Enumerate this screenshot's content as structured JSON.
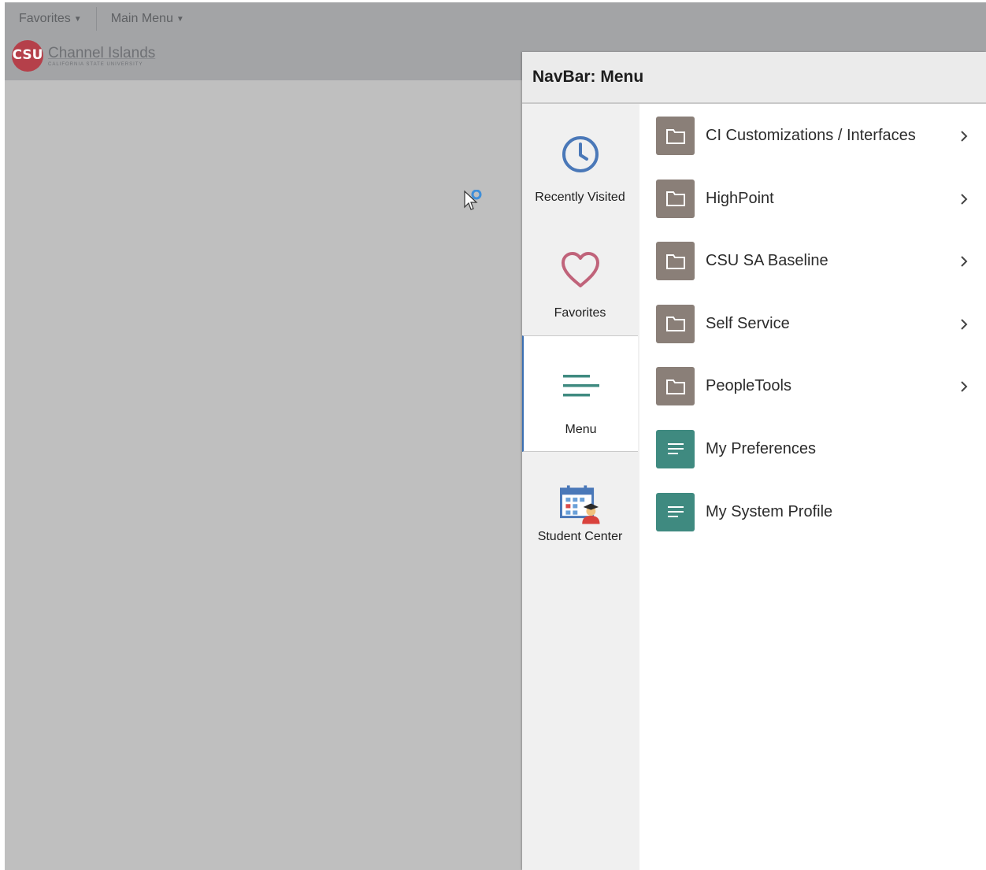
{
  "background": {
    "topnav": {
      "favorites_label": "Favorites",
      "main_menu_label": "Main Menu"
    },
    "brand": {
      "name": "Channel Islands",
      "subtitle": "CALIFORNIA STATE UNIVERSITY",
      "mark_text": "CSU"
    }
  },
  "navbar": {
    "title": "NavBar: Menu",
    "rail": [
      {
        "label": "Recently Visited",
        "icon": "clock-icon"
      },
      {
        "label": "Favorites",
        "icon": "heart-icon"
      },
      {
        "label": "Menu",
        "icon": "menu-lines-icon",
        "active": true
      },
      {
        "label": "Student Center",
        "icon": "calendar-student-icon"
      }
    ],
    "items": [
      {
        "label": "CI Customizations / Interfaces",
        "type": "folder"
      },
      {
        "label": "HighPoint",
        "type": "folder"
      },
      {
        "label": "CSU SA Baseline",
        "type": "folder"
      },
      {
        "label": "Self Service",
        "type": "folder"
      },
      {
        "label": "PeopleTools",
        "type": "folder"
      },
      {
        "label": "My Preferences",
        "type": "page"
      },
      {
        "label": "My System Profile",
        "type": "page"
      }
    ]
  },
  "colors": {
    "folder_tile": "#8a7f78",
    "page_tile": "#3f8a80",
    "active_accent": "#3b6fb2",
    "clock_blue": "#4a78b8",
    "heart_pink": "#c0637a",
    "menu_teal": "#3f8a80"
  }
}
